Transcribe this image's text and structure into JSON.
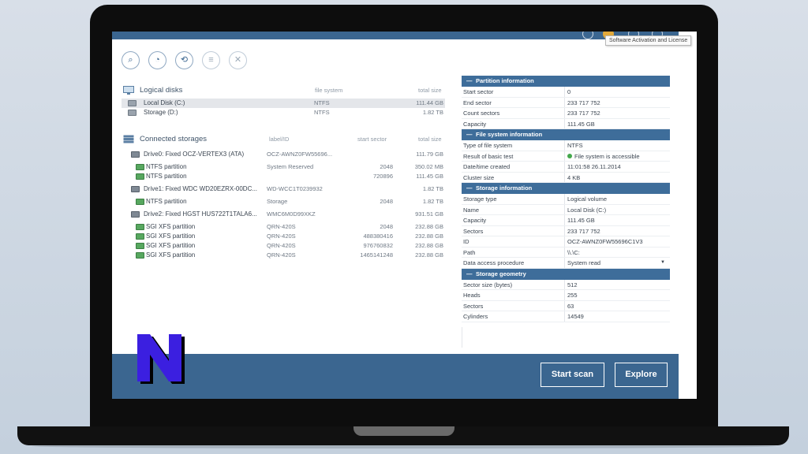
{
  "tooltip": "Software Activation and License",
  "toolbar": [
    {
      "icon": "search-icon",
      "glyph": "⌕"
    },
    {
      "icon": "disk-image-icon",
      "glyph": "◔"
    },
    {
      "icon": "open-image-icon",
      "glyph": "⟲"
    },
    {
      "icon": "list-icon",
      "glyph": "≡"
    },
    {
      "icon": "close-icon",
      "glyph": "✕"
    }
  ],
  "logical_disks": {
    "title": "Logical disks",
    "col_filesystem": "file system",
    "col_totalsize": "total size",
    "items": [
      {
        "name": "Local Disk (C:)",
        "fs": "NTFS",
        "size": "111.44 GB"
      },
      {
        "name": "Storage (D:)",
        "fs": "NTFS",
        "size": "1.82 TB"
      }
    ]
  },
  "connected_storages": {
    "title": "Connected storages",
    "col_label": "label/ID",
    "col_start": "start sector",
    "col_totalsize": "total size",
    "rows": [
      {
        "type": "drive",
        "name": "Drive0: Fixed OCZ-VERTEX3 (ATA)",
        "label": "OCZ-AWNZ0FW55696...",
        "start": "",
        "size": "111.79 GB"
      },
      {
        "type": "part",
        "name": "NTFS partition",
        "label": "System Reserved",
        "start": "2048",
        "size": "350.02 MB"
      },
      {
        "type": "part",
        "name": "NTFS partition",
        "label": "",
        "start": "720896",
        "size": "111.45 GB"
      },
      {
        "type": "drive",
        "name": "Drive1: Fixed WDC WD20EZRX-00DC...",
        "label": "WD-WCC1T0239932",
        "start": "",
        "size": "1.82 TB"
      },
      {
        "type": "part",
        "name": "NTFS partition",
        "label": "Storage",
        "start": "2048",
        "size": "1.82 TB"
      },
      {
        "type": "drive",
        "name": "Drive2: Fixed HGST HUS722T1TALA6...",
        "label": "WMC6M0D99XKZ",
        "start": "",
        "size": "931.51 GB"
      },
      {
        "type": "part",
        "name": "SGI XFS partition",
        "label": "QRN-420S",
        "start": "2048",
        "size": "232.88 GB"
      },
      {
        "type": "part",
        "name": "SGI XFS partition",
        "label": "QRN-420S",
        "start": "488380416",
        "size": "232.88 GB"
      },
      {
        "type": "part",
        "name": "SGI XFS partition",
        "label": "QRN-420S",
        "start": "976760832",
        "size": "232.88 GB"
      },
      {
        "type": "part",
        "name": "SGI XFS partition",
        "label": "QRN-420S",
        "start": "1465141248",
        "size": "232.88 GB"
      }
    ]
  },
  "properties": [
    {
      "group": "Partition information",
      "rows": [
        {
          "k": "Start sector",
          "v": "0"
        },
        {
          "k": "End sector",
          "v": "233 717 752"
        },
        {
          "k": "Count sectors",
          "v": "233 717 752"
        },
        {
          "k": "Capacity",
          "v": "111.45 GB"
        }
      ]
    },
    {
      "group": "File system information",
      "rows": [
        {
          "k": "Type of file system",
          "v": "NTFS"
        },
        {
          "k": "Result of basic test",
          "v": "File system is accessible",
          "status": "ok"
        },
        {
          "k": "Date/time created",
          "v": "11:01:58 26.11.2014"
        },
        {
          "k": "Cluster size",
          "v": "4 KB"
        }
      ]
    },
    {
      "group": "Storage information",
      "rows": [
        {
          "k": "Storage type",
          "v": "Logical volume"
        },
        {
          "k": "Name",
          "v": "Local Disk (C:)"
        },
        {
          "k": "Capacity",
          "v": "111.45 GB"
        },
        {
          "k": "Sectors",
          "v": "233 717 752"
        },
        {
          "k": "ID",
          "v": "OCZ-AWNZ0FW55696C1V3"
        },
        {
          "k": "Path",
          "v": "\\\\.\\C:"
        },
        {
          "k": "Data access procedure",
          "v": "System read",
          "dropdown": true
        }
      ]
    },
    {
      "group": "Storage geometry",
      "rows": [
        {
          "k": "Sector size (bytes)",
          "v": "512"
        },
        {
          "k": "Heads",
          "v": "255"
        },
        {
          "k": "Sectors",
          "v": "63"
        },
        {
          "k": "Cylinders",
          "v": "14549"
        }
      ]
    }
  ],
  "buttons": {
    "start_scan": "Start scan",
    "explore": "Explore"
  },
  "colors": {
    "accent": "#3b6690",
    "header": "#3e6d9a",
    "status_ok": "#44a84c",
    "logo": "#3b1fe0"
  }
}
